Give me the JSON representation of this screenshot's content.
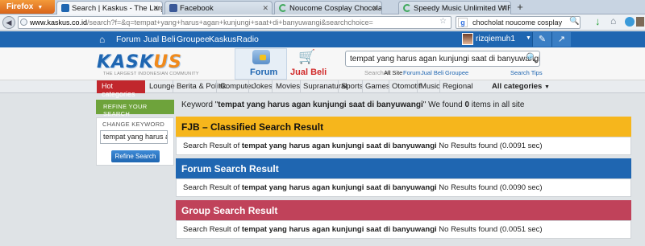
{
  "browser": {
    "app_button": "Firefox",
    "tabs": [
      {
        "title": "Search | Kaskus - The Largest Indones...",
        "active": true,
        "icon": "kaskus-favicon"
      },
      {
        "title": "Facebook",
        "active": false,
        "icon": "facebook-favicon"
      },
      {
        "title": "Noucome Cosplay Chocolat Red Dres...",
        "active": false,
        "icon": "loading-spinner"
      },
      {
        "title": "Speedy Music Unlimited WIFI.ID | Des...",
        "active": false,
        "icon": "loading-spinner"
      }
    ],
    "url_host": "www.kaskus.co.id",
    "url_rest": "/search?f=&q=tempat+yang+harus+agan+kunjungi+saat+di+banyuwangi&searchchoice=",
    "search_value": "chocholat noucome cosplay"
  },
  "topnav": {
    "links": [
      "Forum",
      "Jual Beli",
      "Groupee",
      "KaskusRadio"
    ],
    "username": "rizqiemuh1"
  },
  "header": {
    "logo_prefix": "KASK",
    "logo_suffix": "US",
    "tagline": "THE LARGEST INDONESIAN COMMUNITY",
    "forum_label": "Forum",
    "jualbeli_label": "Jual Beli",
    "search_value": "tempat yang harus agan kunjungi saat di banyuwangi",
    "search_in_label": "Search in:",
    "search_options": [
      "All Site",
      "Forum",
      "Jual Beli",
      "Groupee"
    ],
    "search_tips": "Search Tips"
  },
  "categories": {
    "hot_label": "Hot categories",
    "items": [
      "Lounge",
      "Berita & Politik",
      "Computer",
      "Jokes",
      "Movies",
      "Supranatural",
      "Sports",
      "Games",
      "Otomotif",
      "Music",
      "Regional"
    ],
    "all_label": "All categories"
  },
  "sidebar": {
    "refine_title": "REFINE YOUR SEARCH",
    "change_label": "CHANGE KEYWORD",
    "input_value": "tempat yang harus agan",
    "refine_button": "Refine Search"
  },
  "summary": {
    "prefix": "Keyword \"",
    "keyword": "tempat yang harus agan kunjungi saat di banyuwangi",
    "middle": "\" We found ",
    "count": "0",
    "suffix": " items in all site"
  },
  "results": [
    {
      "title": "FJB – Classified Search Result",
      "prefix": "Search Result of ",
      "keyword": "tempat yang harus agan kunjungi saat di banyuwangi",
      "status": " No Results found (0.0091 sec)"
    },
    {
      "title": "Forum Search Result",
      "prefix": "Search Result of ",
      "keyword": "tempat yang harus agan kunjungi saat di banyuwangi",
      "status": " No Results found (0.0090 sec)"
    },
    {
      "title": "Group Search Result",
      "prefix": "Search Result of ",
      "keyword": "tempat yang harus agan kunjungi saat di banyuwangi",
      "status": " No Results found (0.0051 sec)"
    }
  ],
  "colors": {
    "kaskus_blue": "#1f66b1",
    "fjb_yellow": "#f6b61c",
    "group_pink": "#c0425a",
    "refine_green": "#6ea33b",
    "hot_red": "#c1272d"
  }
}
